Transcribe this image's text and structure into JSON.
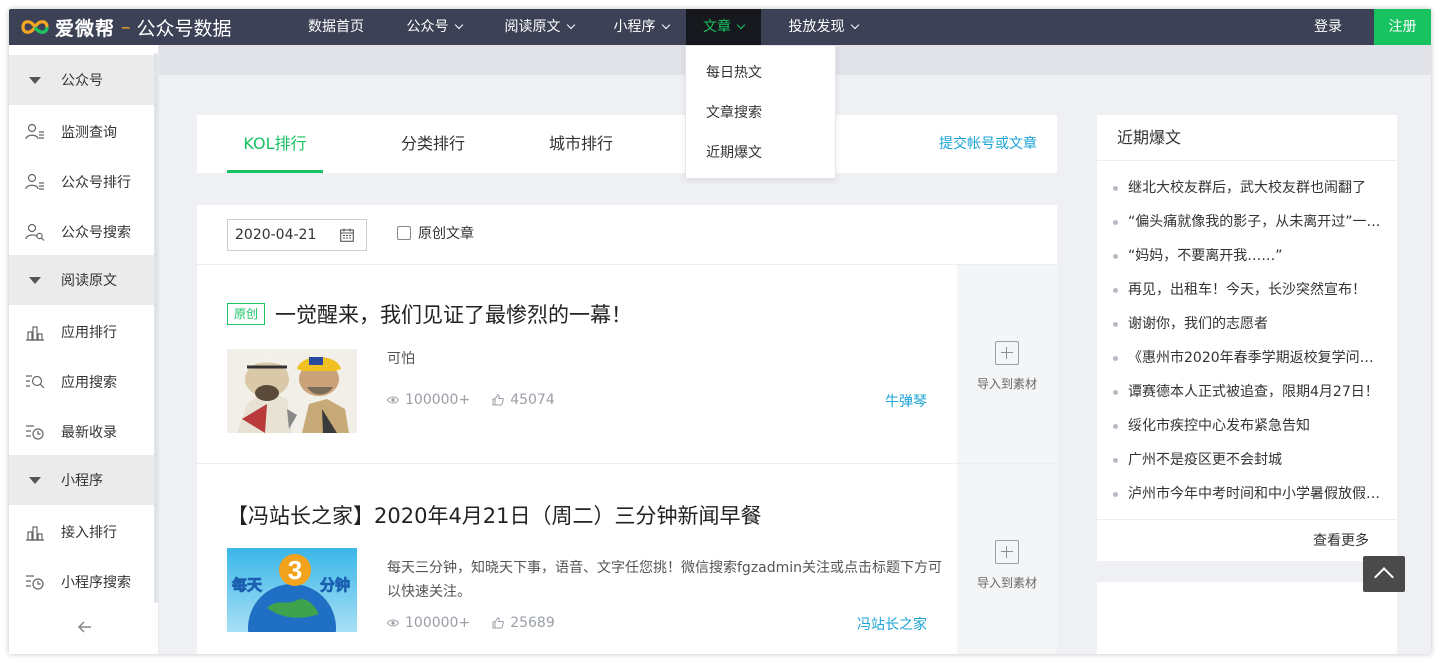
{
  "brand": {
    "name": "爱微帮",
    "dash": "–",
    "subtitle": "公众号数据"
  },
  "topnav": {
    "items": [
      {
        "label": "数据首页",
        "has_chevron": false
      },
      {
        "label": "公众号",
        "has_chevron": true
      },
      {
        "label": "阅读原文",
        "has_chevron": true
      },
      {
        "label": "小程序",
        "has_chevron": true
      },
      {
        "label": "文章",
        "has_chevron": true,
        "active": true
      },
      {
        "label": "投放发现",
        "has_chevron": true
      }
    ],
    "login": "登录",
    "register": "注册"
  },
  "dropdown": {
    "items": [
      "每日热文",
      "文章搜索",
      "近期爆文"
    ]
  },
  "sidebar": {
    "sections": [
      {
        "label": "公众号",
        "items": [
          {
            "label": "监测查询",
            "icon": "user-list-icon"
          },
          {
            "label": "公众号排行",
            "icon": "user-rank-icon"
          },
          {
            "label": "公众号搜索",
            "icon": "user-search-icon"
          }
        ]
      },
      {
        "label": "阅读原文",
        "items": [
          {
            "label": "应用排行",
            "icon": "bar-chart-icon"
          },
          {
            "label": "应用搜索",
            "icon": "list-search-icon"
          },
          {
            "label": "最新收录",
            "icon": "list-clock-icon"
          }
        ]
      },
      {
        "label": "小程序",
        "items": [
          {
            "label": "接入排行",
            "icon": "bar-chart-icon"
          },
          {
            "label": "小程序搜索",
            "icon": "list-clock-icon"
          }
        ]
      }
    ]
  },
  "tabs": {
    "items": [
      "KOL排行",
      "分类排行",
      "城市排行"
    ],
    "active": "KOL排行",
    "submit_link": "提交帐号或文章"
  },
  "filter": {
    "date": "2020-04-21",
    "original_label": "原创文章",
    "original_checked": false
  },
  "articles": [
    {
      "badge": "原创",
      "title": "一觉醒来，我们见证了最惨烈的一幕！",
      "desc": "可怕",
      "views": "100000+",
      "likes": "45074",
      "author": "牛弹琴",
      "import_label": "导入到素材"
    },
    {
      "badge": "",
      "title": "【冯站长之家】2020年4月21日（周二）三分钟新闻早餐",
      "desc": "每天三分钟，知晓天下事，语音、文字任您挑！微信搜索fgzadmin关注或点击标题下方可以快速关注。",
      "views": "100000+",
      "likes": "25689",
      "author": "冯站长之家",
      "import_label": "导入到素材",
      "thumb_text": "每天3分钟"
    }
  ],
  "hot": {
    "title": "近期爆文",
    "items": [
      "继北大校友群后，武大校友群也闹翻了",
      "“偏头痛就像我的影子，从未离开过”一…",
      "“妈妈，不要离开我……”",
      "再见，出租车！今天，长沙突然宣布！",
      "谢谢你，我们的志愿者",
      "《惠州市2020年春季学期返校复学问…",
      "谭赛德本人正式被追查，限期4月27日！",
      "绥化市疾控中心发布紧急告知",
      "广州不是疫区更不会封城",
      "泸州市今年中考时间和中小学暑假放假…"
    ],
    "more": "查看更多"
  },
  "colors": {
    "nav_bg": "#3d4156",
    "accent_green": "#17c261",
    "link_blue": "#1aa3d6"
  }
}
